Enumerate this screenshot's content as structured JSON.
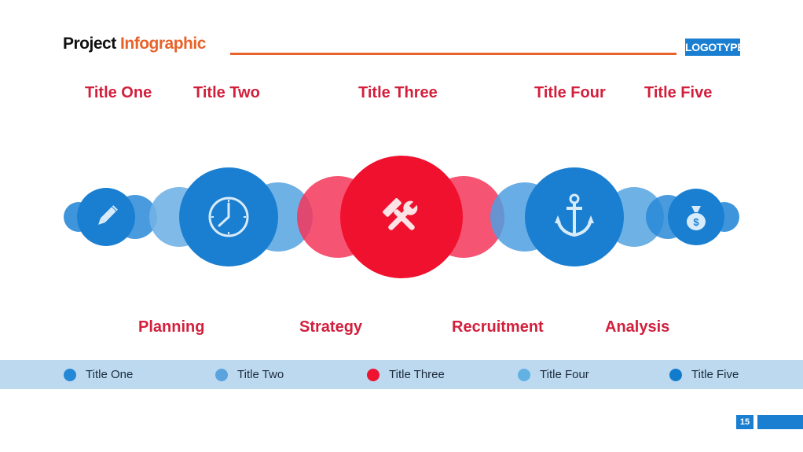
{
  "header": {
    "title_part1": "Project",
    "title_part2": "Infographic",
    "logo": "LOGOTYPE"
  },
  "top_titles": [
    "Title One",
    "Title Two",
    "Title Three",
    "Title Four",
    "Title Five"
  ],
  "bottom_labels": [
    "Planning",
    "Strategy",
    "Recruitment",
    "Analysis"
  ],
  "nodes": [
    {
      "icon": "pencil-icon",
      "color": "#1a7fd1"
    },
    {
      "icon": "clock-icon",
      "color": "#1a7fd1"
    },
    {
      "icon": "tools-icon",
      "color": "#f0112f"
    },
    {
      "icon": "anchor-icon",
      "color": "#1a7fd1"
    },
    {
      "icon": "money-bag-icon",
      "color": "#1a7fd1"
    }
  ],
  "legend": [
    {
      "label": "Title One",
      "color": "#2389d6"
    },
    {
      "label": "Title Two",
      "color": "#5aa3de"
    },
    {
      "label": "Title Three",
      "color": "#ee1430"
    },
    {
      "label": "Title Four",
      "color": "#62b1e3"
    },
    {
      "label": "Title Five",
      "color": "#127ccc"
    }
  ],
  "footer": {
    "page_number": "15"
  },
  "colors": {
    "accent_orange": "#e8622a",
    "primary_blue": "#1a7fd1",
    "primary_red": "#f0112f",
    "title_red": "#d21f3c"
  }
}
